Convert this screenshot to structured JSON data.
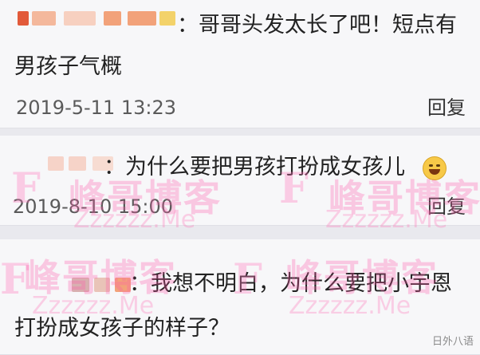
{
  "comments": [
    {
      "text_line1": "：哥哥头发太长了吧！短点有",
      "text_line2": "男孩子气概",
      "time": "2019-5-11 13:23",
      "reply": "回复"
    },
    {
      "text_line1": "：为什么要把男孩打扮成女孩儿",
      "time": "2019-8-10 15:00",
      "reply": "回复",
      "emoji": "laughing-tears-emoji"
    },
    {
      "text_line1": "：我想不明白，为什么要把小宇恩",
      "text_line2": "打扮成女孩子的样子？"
    }
  ],
  "watermark": {
    "letter": "F",
    "cn": "峰哥博客",
    "url": "Zzzzzz.Me"
  },
  "source_stamp": "日外八语",
  "colors": {
    "blur_orange": "#f2a27a",
    "blur_red": "#e25a3a",
    "blur_yellow": "#f3d26a",
    "watermark_pink": "#ff5aaa"
  }
}
